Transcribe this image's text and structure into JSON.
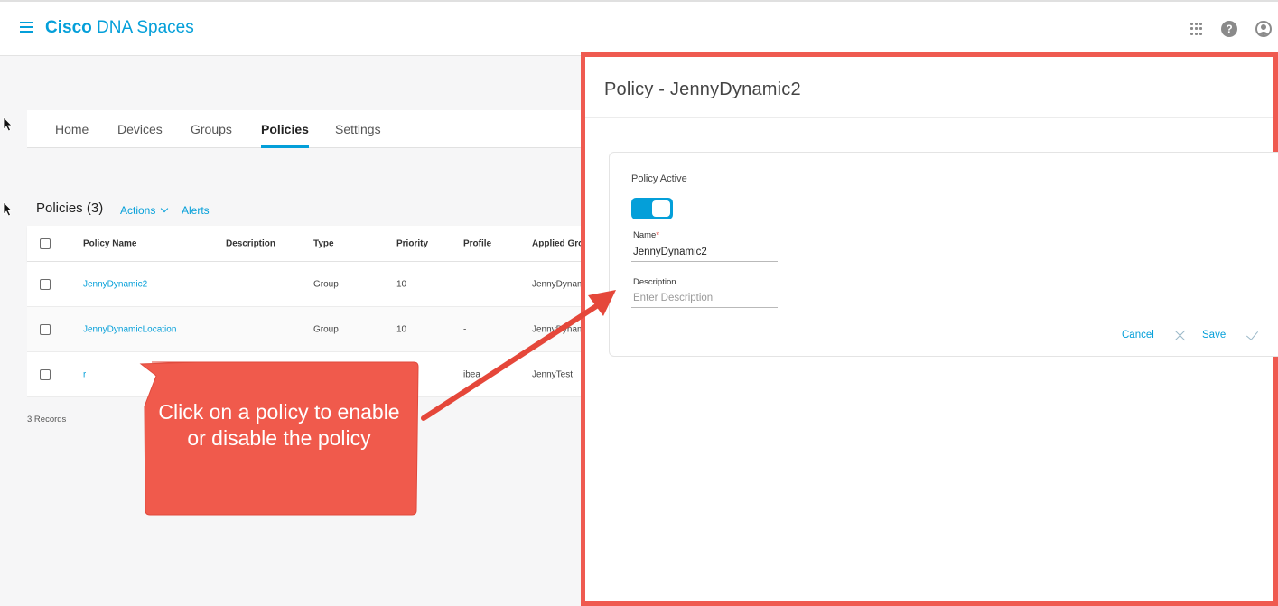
{
  "header": {
    "brand_bold": "Cisco",
    "brand_rest": " DNA Spaces"
  },
  "tabs": [
    {
      "label": "Home",
      "active": false
    },
    {
      "label": "Devices",
      "active": false
    },
    {
      "label": "Groups",
      "active": false
    },
    {
      "label": "Policies",
      "active": true
    },
    {
      "label": "Settings",
      "active": false
    }
  ],
  "policies": {
    "title": "Policies (3)",
    "actions_label": "Actions",
    "alerts_label": "Alerts",
    "columns": [
      "Policy Name",
      "Description",
      "Type",
      "Priority",
      "Profile",
      "Applied Gro"
    ],
    "rows": [
      {
        "name": "JennyDynamic2",
        "description": "",
        "type": "Group",
        "priority": "10",
        "profile": "-",
        "applied_group": "JennyDynam"
      },
      {
        "name": "JennyDynamicLocation",
        "description": "",
        "type": "Group",
        "priority": "10",
        "profile": "-",
        "applied_group": "JennyDynam"
      },
      {
        "name": "r",
        "description": "",
        "type": "",
        "priority": "",
        "profile": "ibea",
        "applied_group": "JennyTest"
      }
    ],
    "records": "3 Records"
  },
  "drawer": {
    "title": "Policy - JennyDynamic2",
    "policy_active_label": "Policy Active",
    "policy_active": true,
    "name_label": "Name",
    "name_required": "*",
    "name_value": "JennyDynamic2",
    "description_label": "Description",
    "description_placeholder": "Enter Description",
    "cancel_label": "Cancel",
    "save_label": "Save"
  },
  "callout": {
    "text": "Click on a policy to enable or disable the policy"
  },
  "colors": {
    "accent": "#049fd9",
    "annotation": "#ef5a50"
  }
}
